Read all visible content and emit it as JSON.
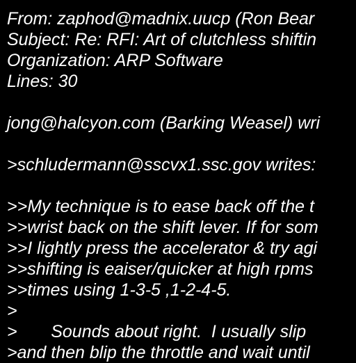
{
  "colors": {
    "background": "#000000",
    "text": "#ffffff"
  },
  "lines": [
    "From: zaphod@madnix.uucp (Ron Bear",
    "Subject: Re: RFI: Art of clutchless shiftin",
    "Organization: ARP Software",
    "Lines: 30",
    "",
    "jong@halcyon.com (Barking Weasel) wri",
    "",
    ">schludermann@sscvx1.ssc.gov writes:",
    "",
    ">>My technique is to ease back off the t",
    ">>wrist back on the shift lever. If for som",
    ">>I lightly press the accelerator & try agi",
    ">>shifting is eaiser/quicker at high rpms",
    ">>times using 1-3-5 ,1-2-4-5.",
    ">",
    ">       Sounds about right.  I usually slip",
    ">and then blip the throttle and wait until"
  ]
}
